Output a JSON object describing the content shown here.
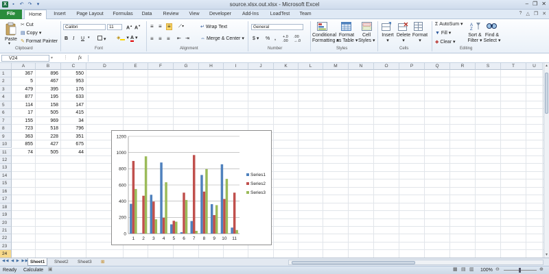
{
  "window": {
    "title": "source.xlsx.out.xlsx - Microsoft Excel",
    "controls": [
      "–",
      "❐",
      "✕"
    ]
  },
  "ribbon_tabs": [
    "File",
    "Home",
    "Insert",
    "Page Layout",
    "Formulas",
    "Data",
    "Review",
    "View",
    "Developer",
    "Add-Ins",
    "LoadTest",
    "Team"
  ],
  "active_tab": "Home",
  "clipboard": {
    "paste": "Paste",
    "cut": "Cut",
    "copy": "Copy",
    "format_painter": "Format Painter",
    "group": "Clipboard"
  },
  "font": {
    "name": "Calibri",
    "size": "11",
    "group": "Font"
  },
  "alignment": {
    "wrap": "Wrap Text",
    "merge": "Merge & Center",
    "group": "Alignment"
  },
  "number": {
    "format": "General",
    "group": "Number"
  },
  "styles": {
    "conditional_1": "Conditional",
    "conditional_2": "Formatting",
    "format_table_1": "Format",
    "format_table_2": "as Table",
    "cell_styles_1": "Cell",
    "cell_styles_2": "Styles",
    "group": "Styles"
  },
  "cells_group": {
    "insert": "Insert",
    "delete": "Delete",
    "format": "Format",
    "group": "Cells"
  },
  "editing": {
    "autosum": "AutoSum",
    "fill": "Fill",
    "clear": "Clear",
    "sort_1": "Sort &",
    "sort_2": "Filter",
    "find_1": "Find &",
    "find_2": "Select",
    "group": "Editing"
  },
  "formula_bar": {
    "name_box": "V24",
    "fx": "fx",
    "value": ""
  },
  "columns": [
    "A",
    "B",
    "C",
    "D",
    "E",
    "F",
    "G",
    "H",
    "I",
    "J",
    "K",
    "L",
    "M",
    "N",
    "O",
    "P",
    "Q",
    "R",
    "S",
    "T",
    "U"
  ],
  "rows": [
    "1",
    "2",
    "3",
    "4",
    "5",
    "6",
    "7",
    "8",
    "9",
    "10",
    "11",
    "12",
    "13",
    "14",
    "15",
    "16",
    "17",
    "18",
    "19",
    "20",
    "21",
    "22",
    "23",
    "24"
  ],
  "selected_row": "24",
  "cells": [
    [
      "367",
      "896",
      "550"
    ],
    [
      "5",
      "467",
      "953"
    ],
    [
      "479",
      "395",
      "176"
    ],
    [
      "877",
      "195",
      "633"
    ],
    [
      "114",
      "158",
      "147"
    ],
    [
      "17",
      "505",
      "415"
    ],
    [
      "155",
      "969",
      "34"
    ],
    [
      "723",
      "518",
      "796"
    ],
    [
      "363",
      "228",
      "351"
    ],
    [
      "855",
      "427",
      "675"
    ],
    [
      "74",
      "505",
      "44"
    ]
  ],
  "chart_data": {
    "type": "bar",
    "categories": [
      "1",
      "2",
      "3",
      "4",
      "5",
      "6",
      "7",
      "8",
      "9",
      "10",
      "11"
    ],
    "series": [
      {
        "name": "Series1",
        "values": [
          367,
          5,
          479,
          877,
          114,
          17,
          155,
          723,
          363,
          855,
          74
        ],
        "color": "#4f81bd"
      },
      {
        "name": "Series2",
        "values": [
          896,
          467,
          395,
          195,
          158,
          505,
          969,
          518,
          228,
          427,
          505
        ],
        "color": "#c0504d"
      },
      {
        "name": "Series3",
        "values": [
          550,
          953,
          176,
          633,
          147,
          415,
          34,
          796,
          351,
          675,
          44
        ],
        "color": "#9bbb59"
      }
    ],
    "ylim": [
      0,
      1200
    ],
    "yticks": [
      "0",
      "200",
      "400",
      "600",
      "800",
      "1000",
      "1200"
    ],
    "grid": true,
    "legend": "right"
  },
  "sheets": [
    "Sheet1",
    "Sheet2",
    "Sheet3"
  ],
  "active_sheet": "Sheet1",
  "status": {
    "ready": "Ready",
    "calculate": "Calculate",
    "zoom": "100%"
  }
}
